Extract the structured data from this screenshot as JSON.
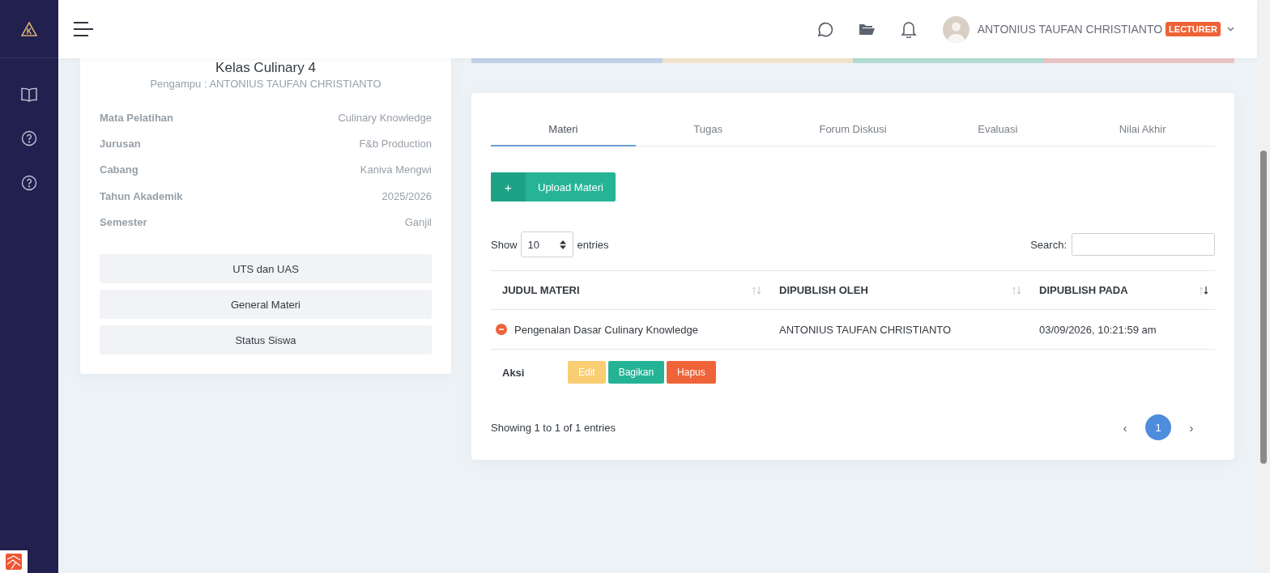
{
  "header": {
    "user_name": "ANTONIUS TAUFAN CHRISTIANTO",
    "role_badge": "LECTURER"
  },
  "class_card": {
    "title": "Kelas Culinary 4",
    "subtitle": "Pengampu : ANTONIUS TAUFAN CHRISTIANTO",
    "details": [
      {
        "label": "Mata Pelatihan",
        "value": "Culinary Knowledge"
      },
      {
        "label": "Jurusan",
        "value": "F&b Production"
      },
      {
        "label": "Cabang",
        "value": "Kaniva Mengwi"
      },
      {
        "label": "Tahun Akademik",
        "value": "2025/2026"
      },
      {
        "label": "Semester",
        "value": "Ganjil"
      }
    ],
    "buttons": [
      "UTS dan UAS",
      "General Materi",
      "Status Siswa"
    ]
  },
  "stat_strip": [
    {
      "color": "#c3d3ea"
    },
    {
      "color": "#f2e6cf"
    },
    {
      "color": "#b4ddd6"
    },
    {
      "color": "#ecc6c6"
    }
  ],
  "tabs": [
    {
      "label": "Materi",
      "selected": true
    },
    {
      "label": "Tugas",
      "selected": false
    },
    {
      "label": "Forum Diskusi",
      "selected": false
    },
    {
      "label": "Evaluasi",
      "selected": false
    },
    {
      "label": "Nilai Akhir",
      "selected": false
    }
  ],
  "upload_button": {
    "icon": "+",
    "label": "Upload Materi"
  },
  "length_control": {
    "show": "Show",
    "value": "10",
    "entries": "entries"
  },
  "search": {
    "label": "Search:"
  },
  "table": {
    "columns": [
      {
        "label": "JUDUL MATERI",
        "sorted": false
      },
      {
        "label": "DIPUBLISH OLEH",
        "sorted": false
      },
      {
        "label": "DIPUBLISH PADA",
        "sorted": true
      }
    ],
    "rows": [
      {
        "expanded": true,
        "cells": [
          "Pengenalan Dasar Culinary Knowledge",
          "ANTONIUS TAUFAN CHRISTIANTO",
          "03/09/2026, 10:21:59 am"
        ],
        "detail": {
          "label": "Aksi",
          "actions": [
            {
              "label": "Edit",
              "kind": "warning"
            },
            {
              "label": "Bagikan",
              "kind": "success"
            },
            {
              "label": "Hapus",
              "kind": "danger"
            }
          ]
        }
      }
    ]
  },
  "info": "Showing 1 to 1 of 1 entries",
  "pagination": {
    "prev": "‹",
    "next": "›",
    "pages": [
      {
        "label": "1",
        "selected": true
      }
    ]
  }
}
